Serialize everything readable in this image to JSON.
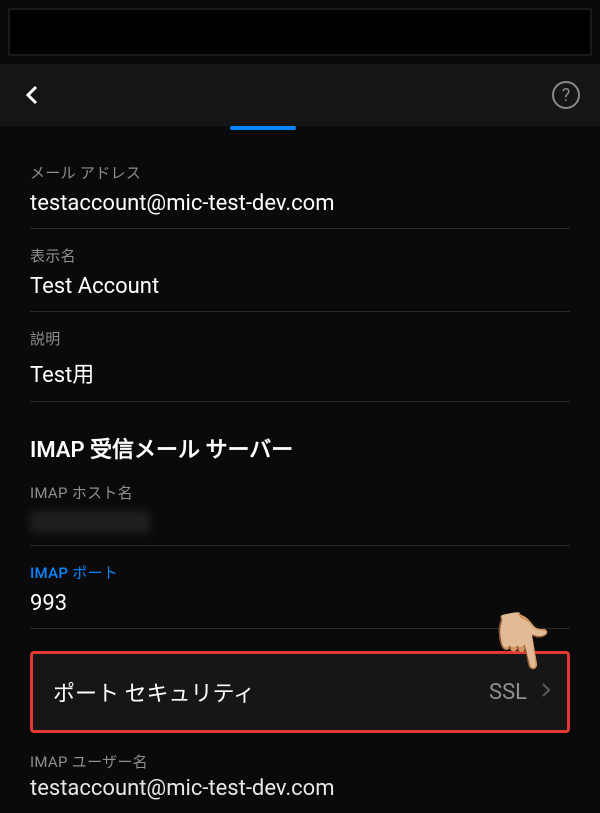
{
  "fields": {
    "email": {
      "label": "メール アドレス",
      "value": "testaccount@mic-test-dev.com"
    },
    "displayName": {
      "label": "表示名",
      "value": "Test Account"
    },
    "description": {
      "label": "説明",
      "value": "Test用"
    }
  },
  "imap": {
    "sectionTitle": "IMAP 受信メール サーバー",
    "host": {
      "label": "IMAP ホスト名"
    },
    "port": {
      "label": "IMAP ポート",
      "value": "993"
    },
    "security": {
      "label": "ポート セキュリティ",
      "value": "SSL"
    },
    "username": {
      "label": "IMAP ユーザー名",
      "value": "testaccount@mic-test-dev.com"
    }
  },
  "icons": {
    "help": "?",
    "hand": "👇🏼"
  }
}
